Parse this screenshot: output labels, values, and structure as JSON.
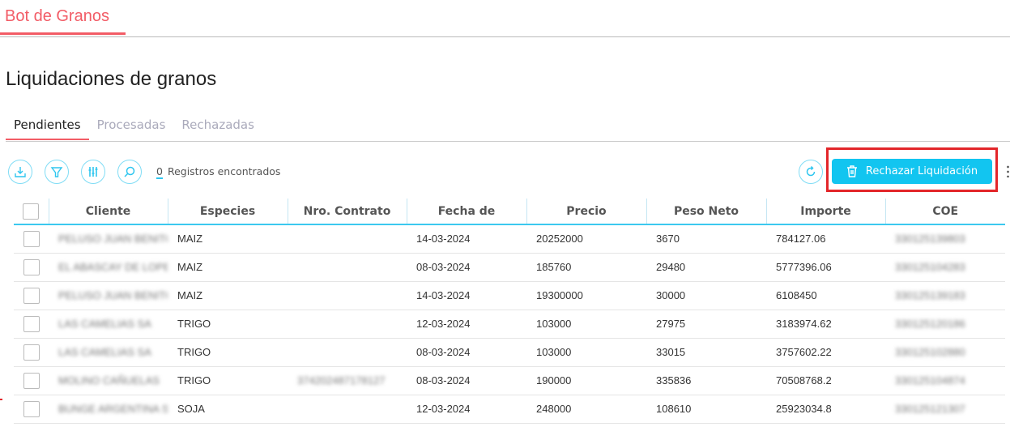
{
  "app": {
    "title": "Bot de Granos"
  },
  "page": {
    "title": "Liquidaciones de granos"
  },
  "tabs": [
    {
      "label": "Pendientes",
      "active": true
    },
    {
      "label": "Procesadas"
    },
    {
      "label": "Rechazadas"
    }
  ],
  "toolbar": {
    "count": "0",
    "count_label": "Registros encontrados",
    "reject_label": "Rechazar Liquidación",
    "icons": [
      "download-icon",
      "filter-icon",
      "columns-icon",
      "search-icon",
      "refresh-icon",
      "trash-icon"
    ]
  },
  "colors": {
    "brand": "#f25c66",
    "accent": "#12c5f0",
    "highlight": "#e3262a"
  },
  "table": {
    "columns": [
      "Cliente",
      "Especies",
      "Nro. Contrato",
      "Fecha de",
      "Precio",
      "Peso Neto",
      "Importe",
      "COE"
    ],
    "rows": [
      [
        "PELUSO JUAN BENITO",
        "MAIZ",
        "",
        "14-03-2024",
        "20252000",
        "3670",
        "784127.06",
        "330125139803"
      ],
      [
        "EL ABASCAY DE LOPEZ",
        "MAIZ",
        "",
        "08-03-2024",
        "185760",
        "29480",
        "5777396.06",
        "330125104283"
      ],
      [
        "PELUSO JUAN BENITO",
        "MAIZ",
        "",
        "14-03-2024",
        "19300000",
        "30000",
        "6108450",
        "330125139183"
      ],
      [
        "LAS CAMELIAS SA",
        "TRIGO",
        "",
        "12-03-2024",
        "103000",
        "27975",
        "3183974.62",
        "330125120186"
      ],
      [
        "LAS CAMELIAS SA",
        "TRIGO",
        "",
        "08-03-2024",
        "103000",
        "33015",
        "3757602.22",
        "330125102880"
      ],
      [
        "MOLINO CAÑUELAS",
        "TRIGO",
        "374202487178127",
        "08-03-2024",
        "190000",
        "335836",
        "70508768.2",
        "330125104874"
      ],
      [
        "BUNGE ARGENTINA S",
        "SOJA",
        "",
        "12-03-2024",
        "248000",
        "108610",
        "25923034.8",
        "330125121307"
      ]
    ]
  }
}
